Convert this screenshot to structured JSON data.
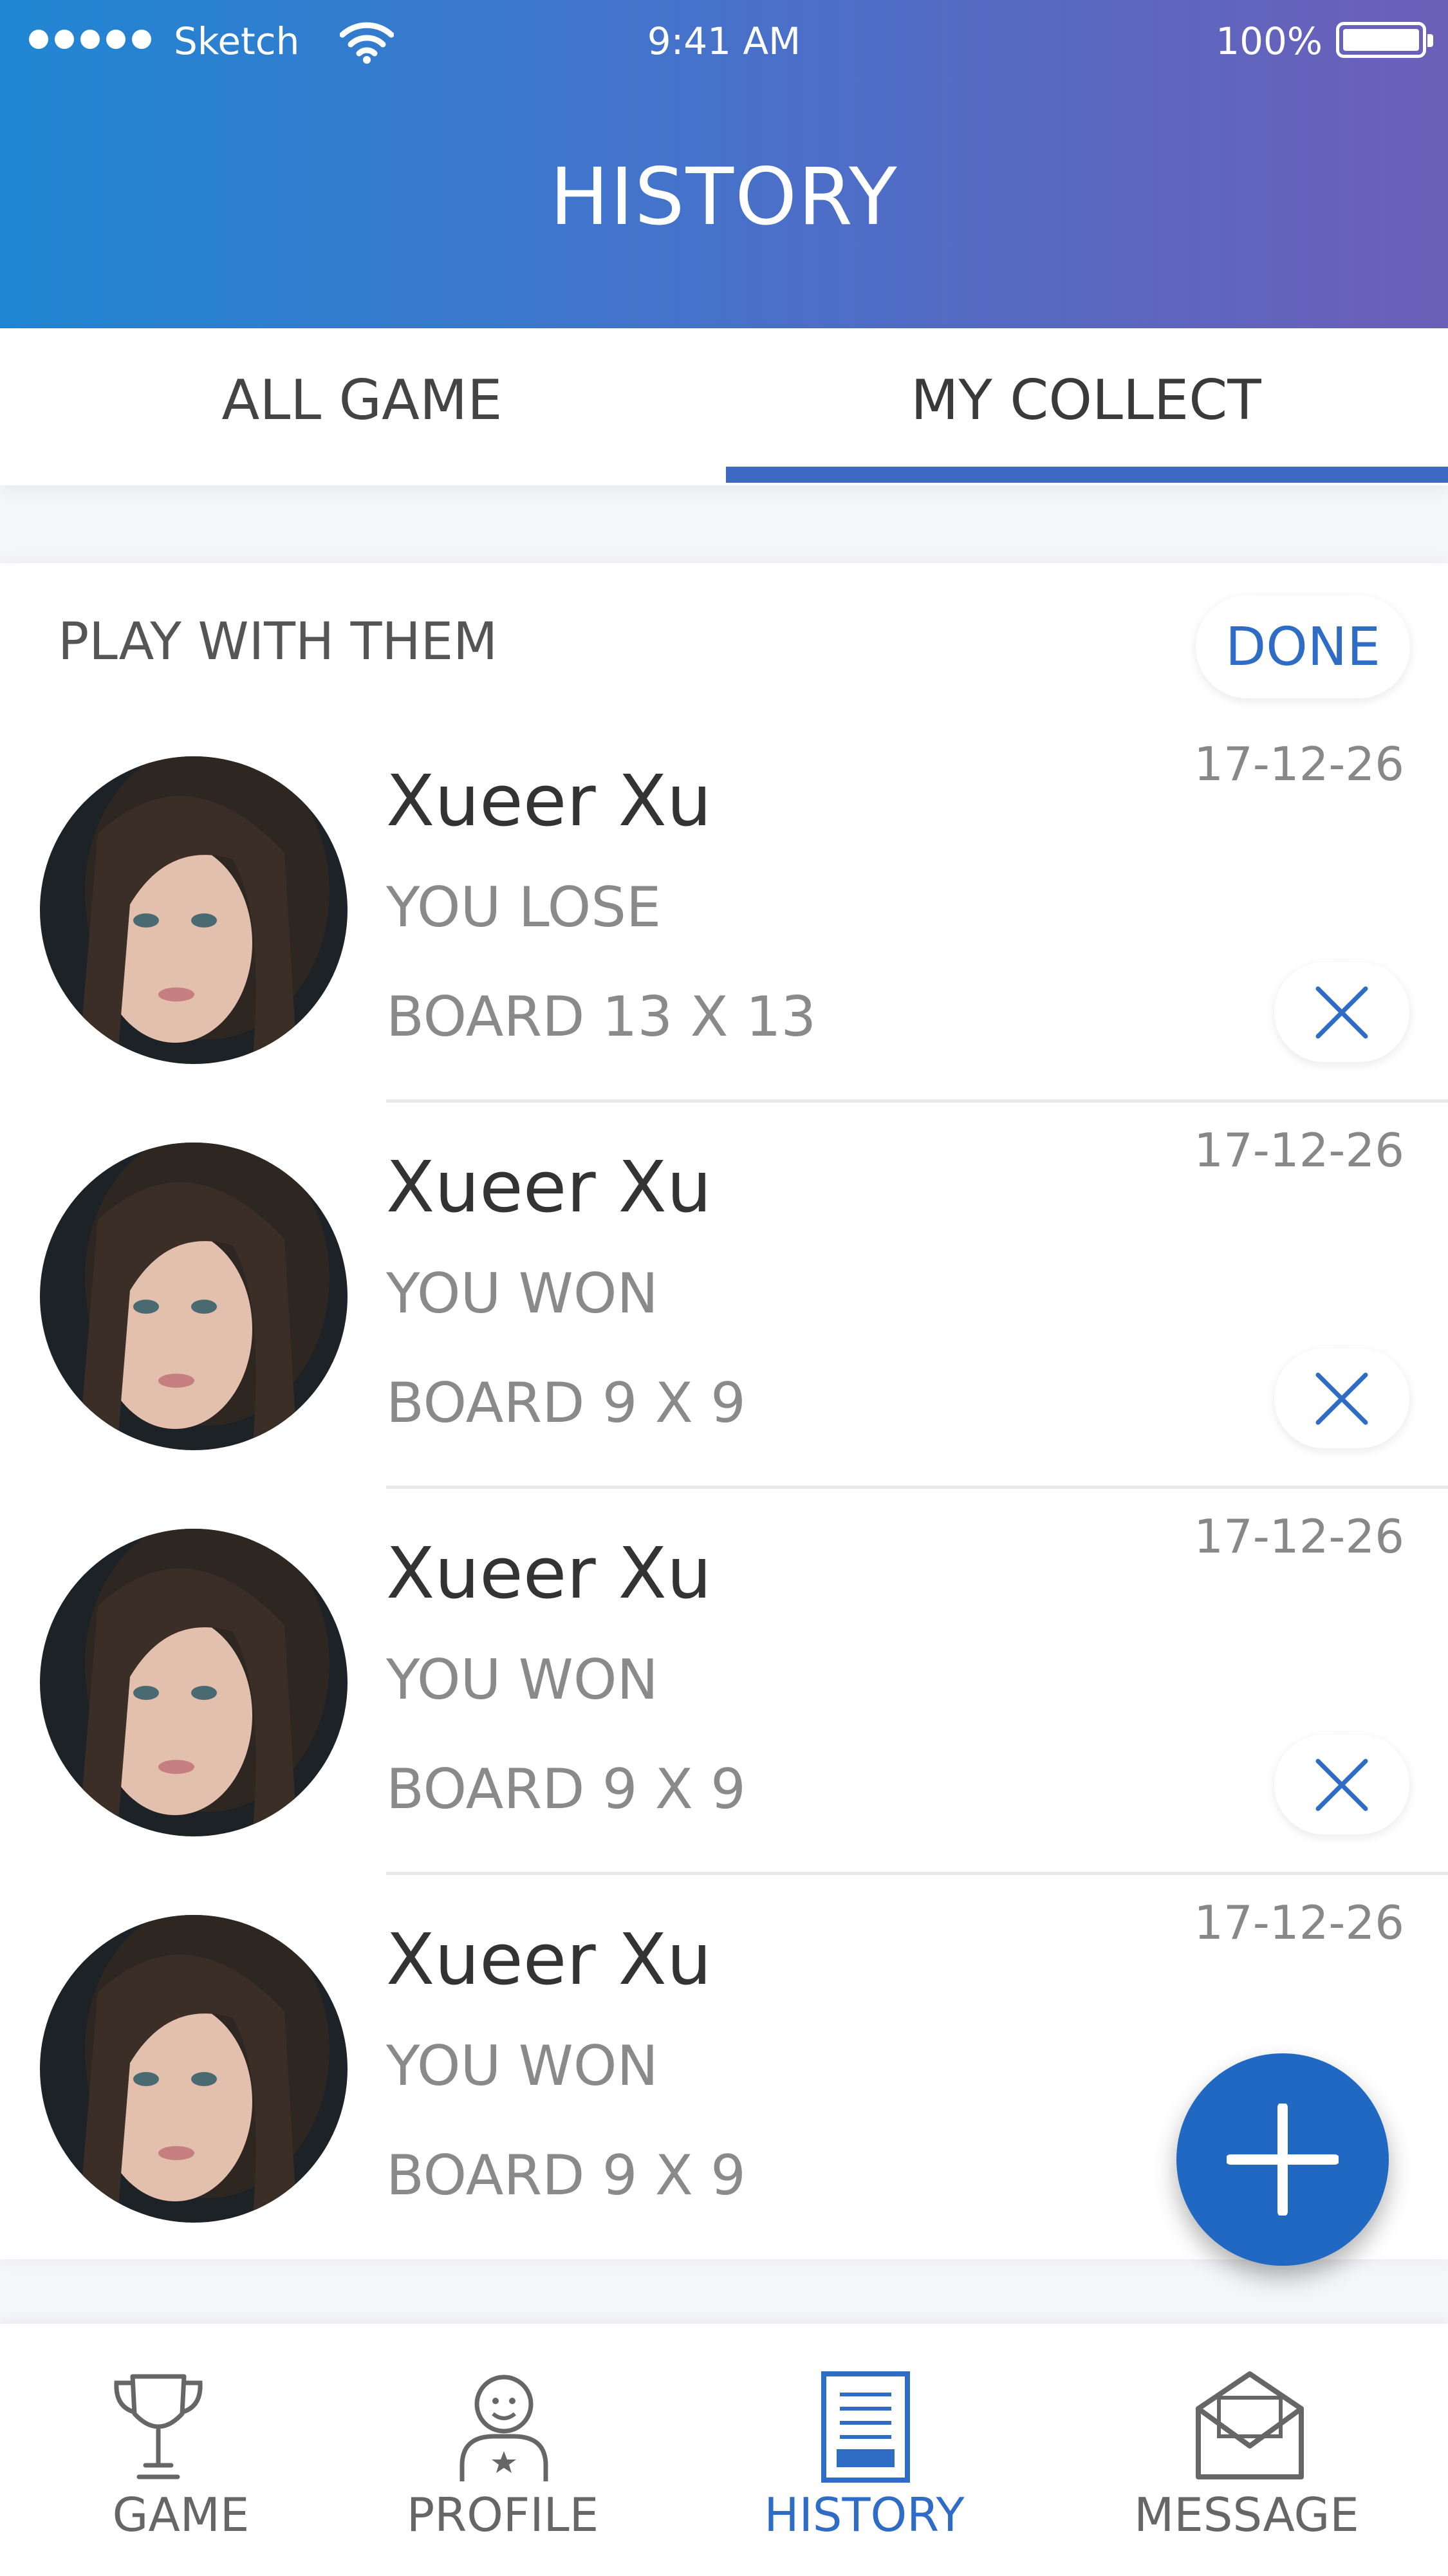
{
  "status_bar": {
    "carrier": "Sketch",
    "time": "9:41 AM",
    "battery": "100%"
  },
  "header": {
    "title": "HISTORY"
  },
  "tabs": [
    {
      "label": "ALL GAME",
      "active": false
    },
    {
      "label": "MY COLLECT",
      "active": true
    }
  ],
  "section": {
    "title": "PLAY WITH THEM",
    "done_label": "DONE"
  },
  "games": [
    {
      "name": "Xueer Xu",
      "result": "YOU LOSE",
      "board": "BOARD 13 X 13",
      "date": "17-12-26"
    },
    {
      "name": "Xueer Xu",
      "result": "YOU WON",
      "board": "BOARD 9 X 9",
      "date": "17-12-26"
    },
    {
      "name": "Xueer Xu",
      "result": "YOU WON",
      "board": "BOARD 9 X 9",
      "date": "17-12-26"
    },
    {
      "name": "Xueer Xu",
      "result": "YOU WON",
      "board": "BOARD 9 X 9",
      "date": "17-12-26"
    }
  ],
  "bottom_nav": [
    {
      "label": "GAME",
      "icon": "trophy-icon",
      "active": false
    },
    {
      "label": "PROFILE",
      "icon": "user-icon",
      "active": false
    },
    {
      "label": "HISTORY",
      "icon": "document-icon",
      "active": true
    },
    {
      "label": "MESSAGE",
      "icon": "envelope-icon",
      "active": false
    }
  ],
  "colors": {
    "accent": "#2f6cc6",
    "header_start": "#1f86d3",
    "header_end": "#6c5fb8"
  }
}
